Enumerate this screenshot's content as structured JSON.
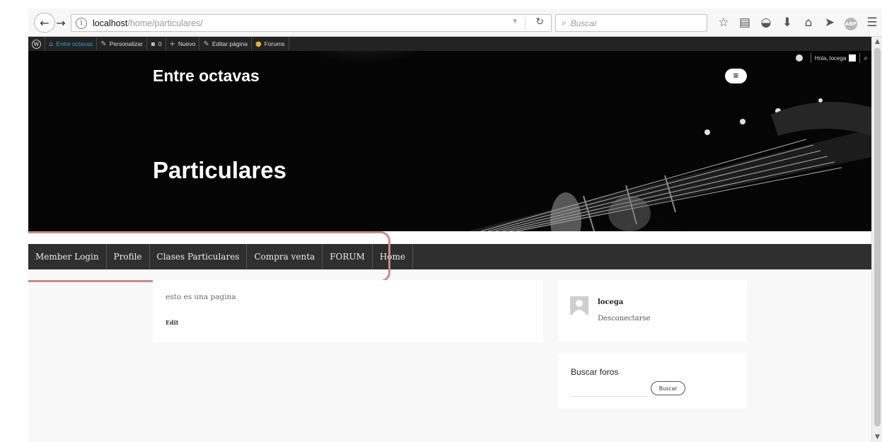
{
  "browser": {
    "url_host": "localhost",
    "url_path": "/home/particulares/",
    "search_placeholder": "Buscar",
    "abp_label": "ABP"
  },
  "admin_bar": {
    "site_name": "Entre octavas",
    "customize": "Personalizar",
    "comments_count": "0",
    "new": "Nuevo",
    "edit_page": "Editar página",
    "forums": "Forums",
    "greeting": "Hola, locega"
  },
  "hero": {
    "site_title": "Entre octavas",
    "page_title": "Particulares"
  },
  "nav": {
    "items": [
      "Member Login",
      "Profile",
      "Clases Particulares",
      "Compra venta",
      "FORUM",
      "Home"
    ]
  },
  "content": {
    "text": "esto es una pagina",
    "edit": "Edit"
  },
  "sidebar": {
    "user": {
      "name": "locega",
      "logout": "Desconectarse"
    },
    "search": {
      "title": "Buscar foros",
      "button": "Buscar"
    }
  },
  "colors": {
    "admin_bar": "#232323",
    "nav_bar": "#2f2f2f",
    "highlight": "#c98a88",
    "site_link": "#2ea2cc"
  }
}
